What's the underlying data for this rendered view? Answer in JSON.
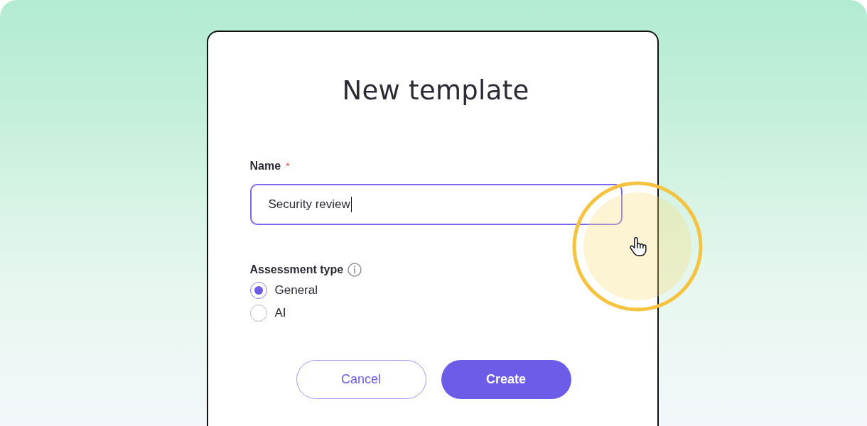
{
  "dialog": {
    "title": "New template",
    "name_field": {
      "label": "Name",
      "required_mark": "*",
      "value": "Security review",
      "focused": true
    },
    "assessment_type": {
      "label": "Assessment type",
      "options": [
        {
          "label": "General",
          "selected": true
        },
        {
          "label": "AI",
          "selected": false
        }
      ]
    },
    "buttons": [
      {
        "label": "Cancel",
        "kind": "secondary"
      },
      {
        "label": "Create",
        "kind": "primary"
      }
    ]
  }
}
